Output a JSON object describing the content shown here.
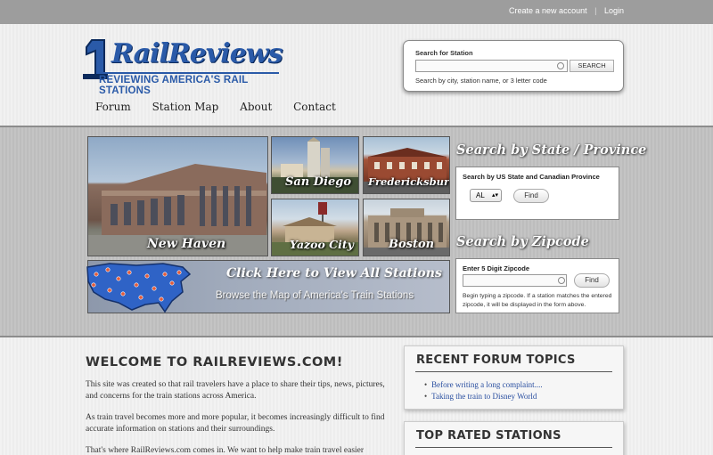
{
  "topbar": {
    "create_account": "Create a new account",
    "login": "Login",
    "separator": "|"
  },
  "logo": {
    "name": "RailReviews",
    "tagline": "REVIEWING AMERICA'S RAIL STATIONS"
  },
  "search": {
    "label": "Search for Station",
    "value": "",
    "button": "SEARCH",
    "hint": "Search by city, station name, or 3 letter code"
  },
  "nav": {
    "items": [
      "Forum",
      "Station Map",
      "About",
      "Contact"
    ]
  },
  "hero": {
    "tiles": [
      {
        "caption": "New Haven"
      },
      {
        "caption": "San Diego"
      },
      {
        "caption": "Fredericksburg"
      },
      {
        "caption": "Yazoo City"
      },
      {
        "caption": "Boston"
      }
    ],
    "map_banner": {
      "title": "Click Here to View All Stations",
      "subtitle": "Browse the Map of America's Train Stations"
    },
    "state_search": {
      "title": "Search by State / Province",
      "label": "Search by US State and Canadian Province",
      "selected": "AL",
      "button": "Find"
    },
    "zip_search": {
      "title": "Search by Zipcode",
      "label": "Enter 5 Digit Zipcode",
      "value": "",
      "button": "Find",
      "hint": "Begin typing a zipcode. If a station matches the entered zipcode, it will be displayed in the form above."
    }
  },
  "content": {
    "welcome_title": "WELCOME TO RAILREVIEWS.COM!",
    "paragraphs": [
      "This site was created so that rail travelers have a place to share their tips, news, pictures, and concerns for the train stations across America.",
      "As train travel becomes more and more popular, it becomes increasingly difficult to find accurate information on stations and their surroundings.",
      "That's where RailReviews.com comes in. We want to help make train travel easier"
    ]
  },
  "sidebar": {
    "recent_title": "RECENT FORUM TOPICS",
    "recent_topics": [
      "Before writing a long complaint....",
      "Taking the train to Disney World"
    ],
    "top_rated_title": "TOP RATED STATIONS"
  },
  "colors": {
    "brand_blue": "#2a5aa8",
    "link_blue": "#2a4fa0",
    "topbar_gray": "#9d9d9d"
  }
}
